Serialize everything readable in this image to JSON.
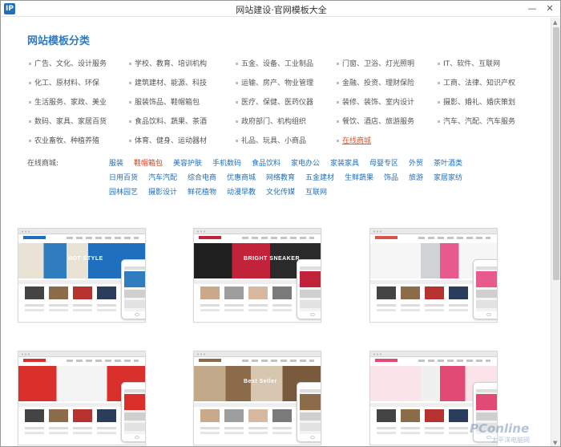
{
  "window": {
    "icon_text": "IP",
    "title": "网站建设·官网模板大全",
    "minimize_glyph": "—",
    "close_glyph": "✕"
  },
  "section_title": "网站模板分类",
  "categories": [
    [
      "广告、文化、设计服务",
      "学校、教育、培训机构",
      "五金、设备、工业制品",
      "门窗、卫浴、灯光照明",
      "IT、软件、互联网"
    ],
    [
      "化工、原材料、环保",
      "建筑建材、能源、科技",
      "运输、房产、物业管理",
      "金融、投资、理财保险",
      "工商、法律、知识产权"
    ],
    [
      "生活服务、家政、美业",
      "服装饰品、鞋帽箱包",
      "医疗、保健、医药仪器",
      "装修、装饰、室内设计",
      "摄影、婚礼、婚庆策划"
    ],
    [
      "数码、家具、家居百货",
      "食品饮料、蔬果、茶酒",
      "政府部门、机构组织",
      "餐饮、酒店、旅游服务",
      "汽车、汽配、汽车服务"
    ],
    [
      "农业畜牧、种植养殖",
      "体育、健身、运动器材",
      "礼品、玩具、小商品",
      "在线商城"
    ]
  ],
  "active_category": "在线商城",
  "online_label": "在线商城:",
  "online_tags": [
    [
      "服装",
      "鞋帽箱包",
      "美容护肤",
      "手机数码",
      "食品饮料",
      "家电办公",
      "家装家具",
      "母婴专区",
      "外贸",
      "茶叶酒类"
    ],
    [
      "日用百货",
      "汽车汽配",
      "综合电商",
      "优惠商城",
      "网络教育",
      "五金建材",
      "生鲜蔬果",
      "饰品",
      "旅游",
      "家居家纺"
    ],
    [
      "园林园艺",
      "摄影设计",
      "鲜花植物",
      "动漫早教",
      "文化传媒",
      "互联网"
    ]
  ],
  "active_tag": "鞋帽箱包",
  "templates": [
    {
      "name": "template-fashion-blue",
      "hero_text": "HOT STYLE",
      "accent": "#1f6fbf"
    },
    {
      "name": "template-shoes-red",
      "hero_text": "BRIGHT SNEAKER",
      "accent": "#c2233a"
    },
    {
      "name": "template-luggage-white",
      "hero_text": "",
      "accent": "#d9534f"
    },
    {
      "name": "template-apparel-red",
      "hero_text": "",
      "accent": "#d9302c"
    },
    {
      "name": "template-bestseller-beige",
      "hero_text": "Best Seller",
      "accent": "#8b6b4a"
    },
    {
      "name": "template-womenwear-pink",
      "hero_text": "",
      "accent": "#e24a76"
    }
  ],
  "watermark": {
    "brand": "PConline",
    "sub": "太平洋电脑网"
  },
  "colors": {
    "link_blue": "#1f6fbf",
    "title_blue": "#2a7bc8",
    "active_orange": "#e0532b"
  }
}
